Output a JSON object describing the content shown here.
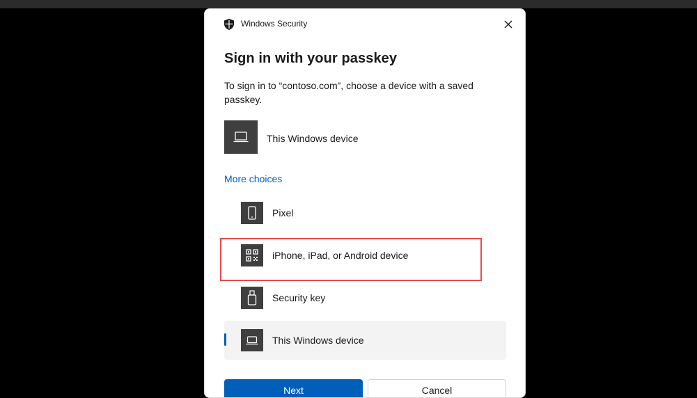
{
  "dialog": {
    "app_title": "Windows Security",
    "heading": "Sign in with your passkey",
    "description": "To sign in to “contoso.com”, choose a device with a saved passkey.",
    "primary_option": {
      "label": "This Windows device",
      "icon": "laptop-icon"
    },
    "more_choices_label": "More choices",
    "options": [
      {
        "label": "Pixel",
        "icon": "phone-icon",
        "selected": false
      },
      {
        "label": "iPhone, iPad, or Android device",
        "icon": "qr-code-icon",
        "selected": false,
        "highlighted": true
      },
      {
        "label": "Security key",
        "icon": "usb-key-icon",
        "selected": false
      },
      {
        "label": "This Windows device",
        "icon": "laptop-icon",
        "selected": true
      }
    ],
    "buttons": {
      "next": "Next",
      "cancel": "Cancel"
    }
  },
  "colors": {
    "accent": "#005fb8",
    "highlight": "#e74c4c",
    "tile": "#3f3f3f",
    "selected_bg": "#f3f3f3"
  }
}
